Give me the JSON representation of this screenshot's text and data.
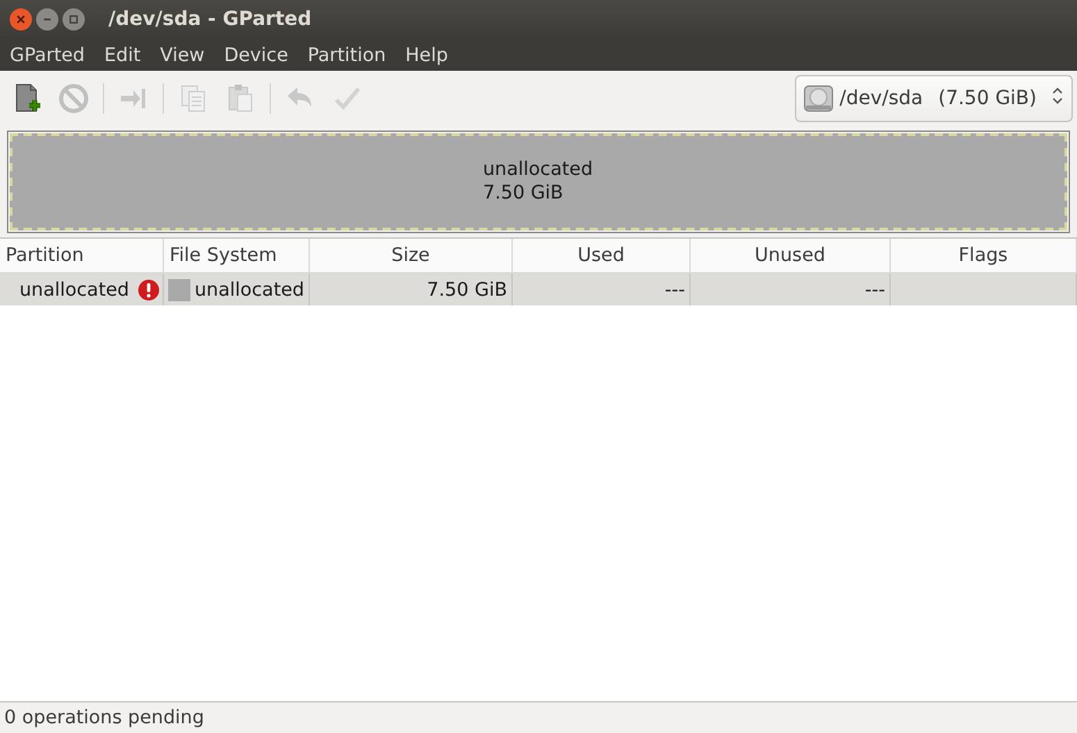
{
  "window": {
    "title": "/dev/sda - GParted"
  },
  "menu": [
    "GParted",
    "Edit",
    "View",
    "Device",
    "Partition",
    "Help"
  ],
  "toolbar": [
    {
      "kind": "new",
      "disabled": false
    },
    {
      "kind": "delete",
      "disabled": true
    },
    {
      "kind": "sep"
    },
    {
      "kind": "resize",
      "disabled": true
    },
    {
      "kind": "sep"
    },
    {
      "kind": "copy",
      "disabled": true
    },
    {
      "kind": "paste",
      "disabled": true
    },
    {
      "kind": "sep"
    },
    {
      "kind": "undo",
      "disabled": true
    },
    {
      "kind": "apply",
      "disabled": true
    }
  ],
  "device_selector": {
    "device": "/dev/sda",
    "size": "(7.50 GiB)"
  },
  "disk_map": [
    {
      "label": "unallocated",
      "size": "7.50 GiB",
      "color": "#a9a9a9"
    }
  ],
  "table": {
    "columns": [
      {
        "label": "Partition"
      },
      {
        "label": "File System"
      },
      {
        "label": "Size"
      },
      {
        "label": "Used"
      },
      {
        "label": "Unused"
      },
      {
        "label": "Flags"
      }
    ],
    "rows": [
      {
        "partition": "unallocated",
        "warning": true,
        "file_system": "unallocated",
        "color": "#a9a9a9",
        "size": "7.50 GiB",
        "used": "---",
        "unused": "---",
        "selected": true
      }
    ]
  },
  "status_bar": "0 operations pending"
}
